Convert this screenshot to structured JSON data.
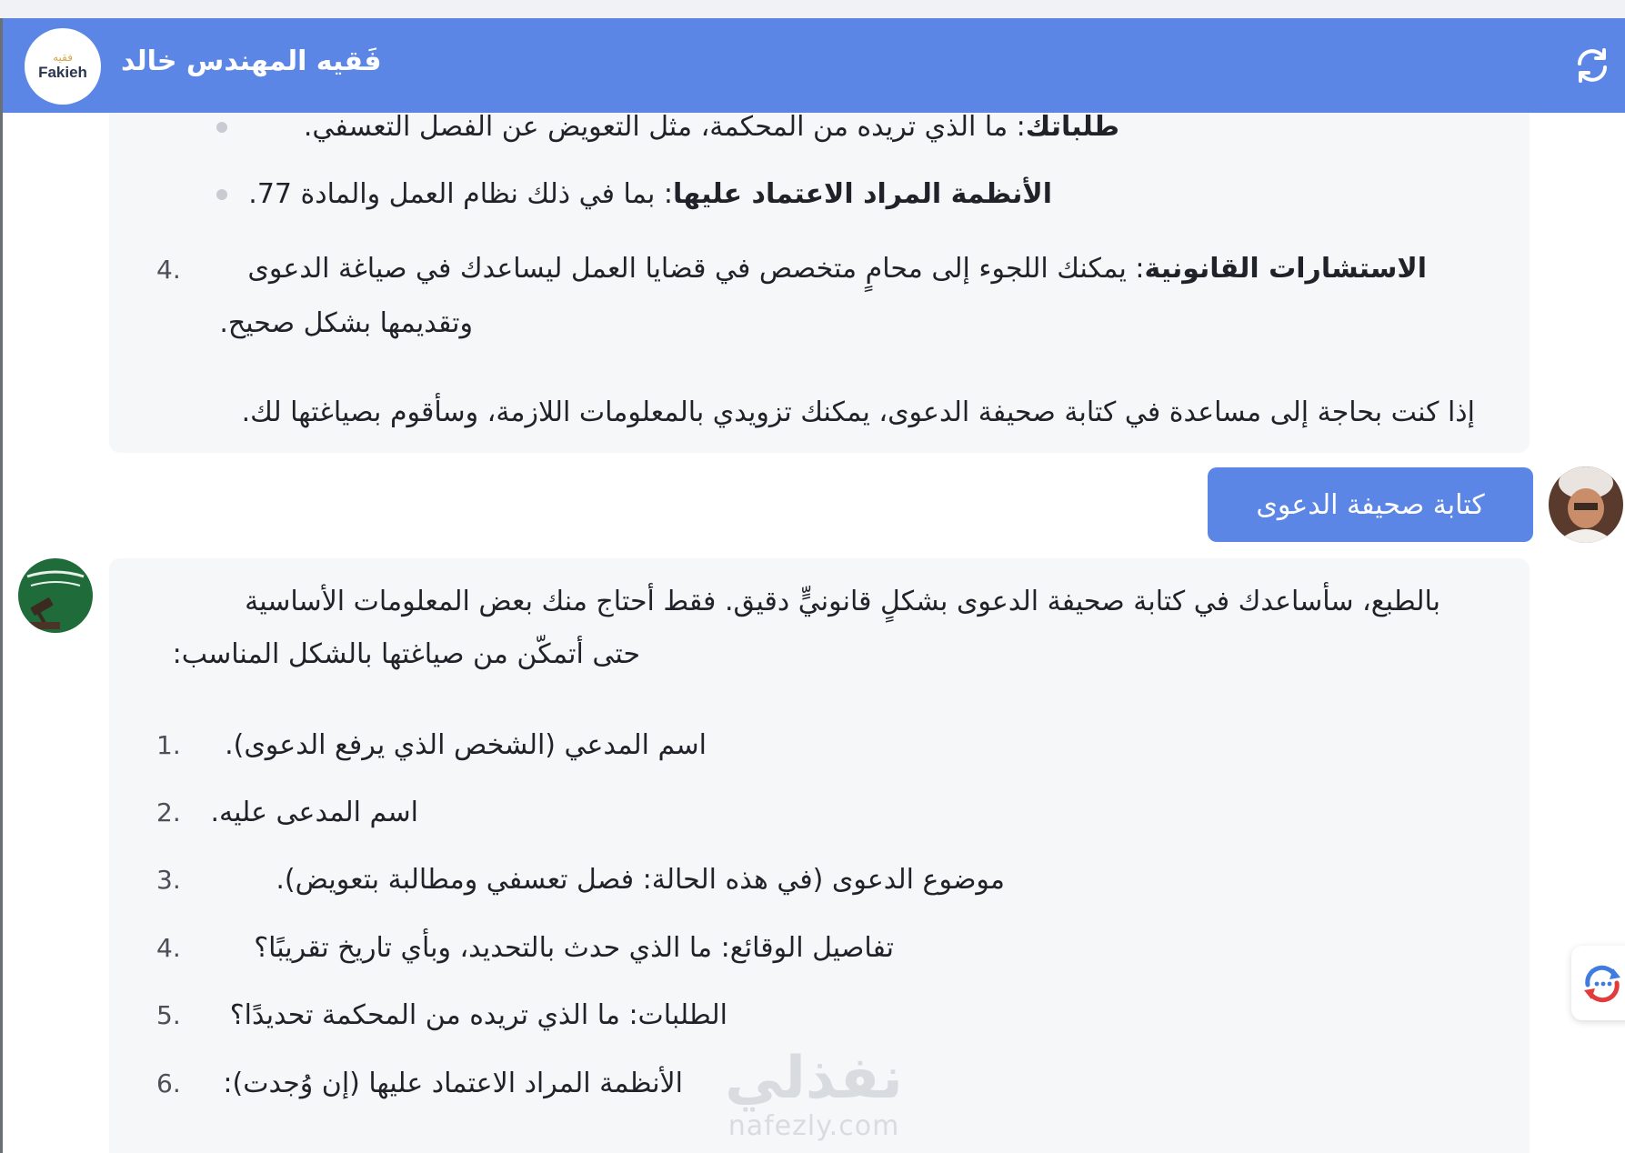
{
  "header": {
    "logo_ar": "فقيه",
    "logo_en": "Fakieh",
    "title": "فَقيه المهندس خالد"
  },
  "message1": {
    "bullet1_bold": "طلباتك",
    "bullet1_text": ": ما الذي تريده من المحكمة، مثل التعويض عن الفصل التعسفي.",
    "bullet2_bold": "الأنظمة المراد الاعتماد عليها",
    "bullet2_text": ": بما في ذلك نظام العمل والمادة 77.",
    "item4_number": "4.",
    "item4_bold": "الاستشارات القانونية",
    "item4_line1": ": يمكنك اللجوء إلى محامٍ متخصص في قضايا العمل ليساعدك في صياغة الدعوى",
    "item4_line2": "وتقديمها بشكل صحيح.",
    "closing": "إذا كنت بحاجة إلى مساعدة في كتابة صحيفة الدعوى، يمكنك تزويدي بالمعلومات اللازمة، وسأقوم بصياغتها لك."
  },
  "user_message": "كتابة صحيفة الدعوى",
  "message2": {
    "intro_line1": "بالطبع، سأساعدك في كتابة صحيفة الدعوى بشكلٍ قانونيٍّ دقيق. فقط أحتاج منك بعض المعلومات الأساسية",
    "intro_line2": "حتى أتمكّن من صياغتها بالشكل المناسب:",
    "items": [
      {
        "number": "1.",
        "text": "اسم المدعي (الشخص الذي يرفع الدعوى)."
      },
      {
        "number": "2.",
        "text": "اسم المدعى عليه."
      },
      {
        "number": "3.",
        "text": "موضوع الدعوى (في هذه الحالة: فصل تعسفي ومطالبة بتعويض)."
      },
      {
        "number": "4.",
        "text": "تفاصيل الوقائع: ما الذي حدث بالتحديد، وبأي تاريخ تقريبًا؟"
      },
      {
        "number": "5.",
        "text": "الطلبات: ما الذي تريده من المحكمة تحديدًا؟"
      },
      {
        "number": "6.",
        "text": "الأنظمة المراد الاعتماد عليها (إن وُجدت):"
      }
    ]
  },
  "watermark": {
    "ar": "نفذلي",
    "en": "nafezly.com"
  },
  "colors": {
    "header": "#5b86e5",
    "user_bubble": "#5b86e5",
    "bot_bubble": "#f6f7f9"
  }
}
